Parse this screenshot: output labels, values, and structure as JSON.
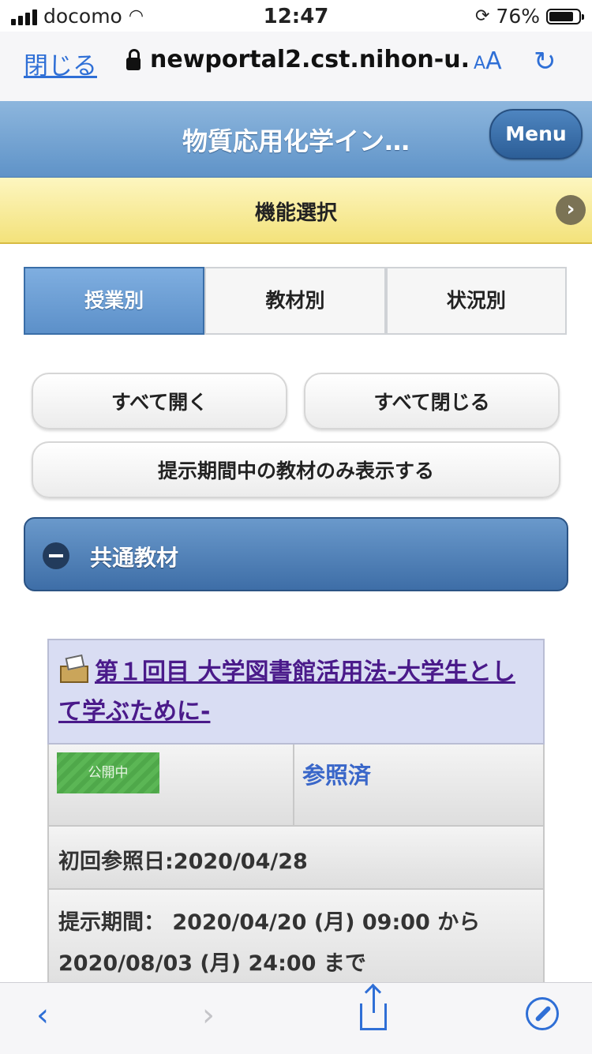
{
  "status_bar": {
    "carrier": "docomo",
    "time": "12:47",
    "battery": "76%",
    "battery_level": 0.76
  },
  "browser": {
    "close_label": "閉じる",
    "url": "newportal2.cst.nihon-u.",
    "text_size_label": "AA",
    "reload_icon": "reload-icon"
  },
  "header": {
    "title": "物質応用化学イン…",
    "menu_label": "Menu"
  },
  "function_bar": {
    "label": "機能選択",
    "arrow": "›"
  },
  "tabs": [
    {
      "label": "授業別",
      "active": true
    },
    {
      "label": "教材別",
      "active": false
    },
    {
      "label": "状況別",
      "active": false
    }
  ],
  "actions": {
    "open_all": "すべて開く",
    "close_all": "すべて閉じる",
    "filter": "提示期間中の教材のみ表示する"
  },
  "section": {
    "title": "共通教材"
  },
  "card": {
    "title": "第１回目 大学図書館活用法-大学生として学ぶために-",
    "badge": "公開中",
    "ref_status": "参照済",
    "first_ref": "初回参照日:2020/04/28",
    "period": "提示期間： 2020/04/20 (月) 09:00 から 2020/08/03 (月) 24:00 まで"
  },
  "toolbar": {
    "back": "‹",
    "forward": "›"
  },
  "colors": {
    "accent_blue": "#2f6fd6",
    "header_blue": "#5f93c8",
    "func_yellow": "#f3e27b",
    "badge_green": "#4fa84a",
    "title_purple": "#4a1a8a"
  }
}
